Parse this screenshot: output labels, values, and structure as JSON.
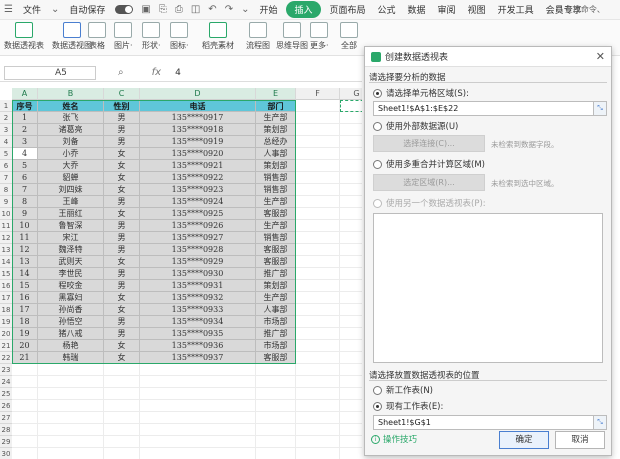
{
  "menubar": {
    "file_label": "文件",
    "autosave_label": "自动保存",
    "tabs": [
      "开始",
      "插入",
      "页面布局",
      "公式",
      "数据",
      "审阅",
      "视图",
      "开发工具",
      "会员专享"
    ],
    "active_tab": "插入",
    "search_label": "Q 查找命令、"
  },
  "ribbon": {
    "buttons": [
      "数据透视表",
      "数据透视图",
      "表格",
      "图片·",
      "形状·",
      "图标·",
      "稻壳素材",
      "流程图",
      "思维导图",
      "更多·",
      "全部"
    ]
  },
  "formula_bar": {
    "name_box": "A5",
    "fx_label": "fx",
    "value": "4"
  },
  "sheet": {
    "columns": [
      "A",
      "B",
      "C",
      "D",
      "E",
      "F",
      "G"
    ],
    "headers": [
      "序号",
      "姓名",
      "性别",
      "电话",
      "部门"
    ],
    "rows": [
      [
        "1",
        "张飞",
        "男",
        "135****0917",
        "生产部"
      ],
      [
        "2",
        "诸葛亮",
        "男",
        "135****0918",
        "策划部"
      ],
      [
        "3",
        "刘备",
        "男",
        "135****0919",
        "总经办"
      ],
      [
        "4",
        "小乔",
        "女",
        "135****0920",
        "人事部"
      ],
      [
        "5",
        "大乔",
        "女",
        "135****0921",
        "策划部"
      ],
      [
        "6",
        "貂蝉",
        "女",
        "135****0922",
        "销售部"
      ],
      [
        "7",
        "刘四妹",
        "女",
        "135****0923",
        "销售部"
      ],
      [
        "8",
        "王峰",
        "男",
        "135****0924",
        "生产部"
      ],
      [
        "9",
        "王丽红",
        "女",
        "135****0925",
        "客服部"
      ],
      [
        "10",
        "鲁智深",
        "男",
        "135****0926",
        "生产部"
      ],
      [
        "11",
        "宋江",
        "男",
        "135****0927",
        "销售部"
      ],
      [
        "12",
        "魏泽特",
        "男",
        "135****0928",
        "客服部"
      ],
      [
        "13",
        "武则天",
        "女",
        "135****0929",
        "客服部"
      ],
      [
        "14",
        "李世民",
        "男",
        "135****0930",
        "推广部"
      ],
      [
        "15",
        "程咬金",
        "男",
        "135****0931",
        "策划部"
      ],
      [
        "16",
        "黑寡妇",
        "女",
        "135****0932",
        "生产部"
      ],
      [
        "17",
        "孙尚香",
        "女",
        "135****0933",
        "人事部"
      ],
      [
        "18",
        "孙悟空",
        "男",
        "135****0934",
        "市场部"
      ],
      [
        "19",
        "猪八戒",
        "男",
        "135****0935",
        "推广部"
      ],
      [
        "20",
        "杨艳",
        "女",
        "135****0936",
        "市场部"
      ],
      [
        "21",
        "韩瑞",
        "女",
        "135****0937",
        "客服部"
      ]
    ]
  },
  "dialog": {
    "title": "创建数据透视表",
    "section1_title": "请选择要分析的数据",
    "opt_select_range": "请选择单元格区域(S):",
    "range_value": "Sheet1!$A$1:$E$22",
    "opt_external": "使用外部数据源(U)",
    "btn_select_connection": "选择连接(C)...",
    "note_no_data": "未检索到数据字段。",
    "opt_multi_range": "使用多重合并计算区域(M)",
    "btn_select_region": "选定区域(R)...",
    "note_no_region": "未检索到选中区域。",
    "opt_another_pivot": "使用另一个数据透视表(P):",
    "section2_title": "请选择放置数据透视表的位置",
    "opt_new_sheet": "新工作表(N)",
    "opt_existing_sheet": "现有工作表(E):",
    "location_value": "Sheet1!$G$1",
    "tips_label": "操作技巧",
    "ok_label": "确定",
    "cancel_label": "取消"
  },
  "colors": {
    "accent_green": "#2aa86a",
    "header_fill": "#5fc6d9",
    "body_fill": "#d9d9d9"
  }
}
